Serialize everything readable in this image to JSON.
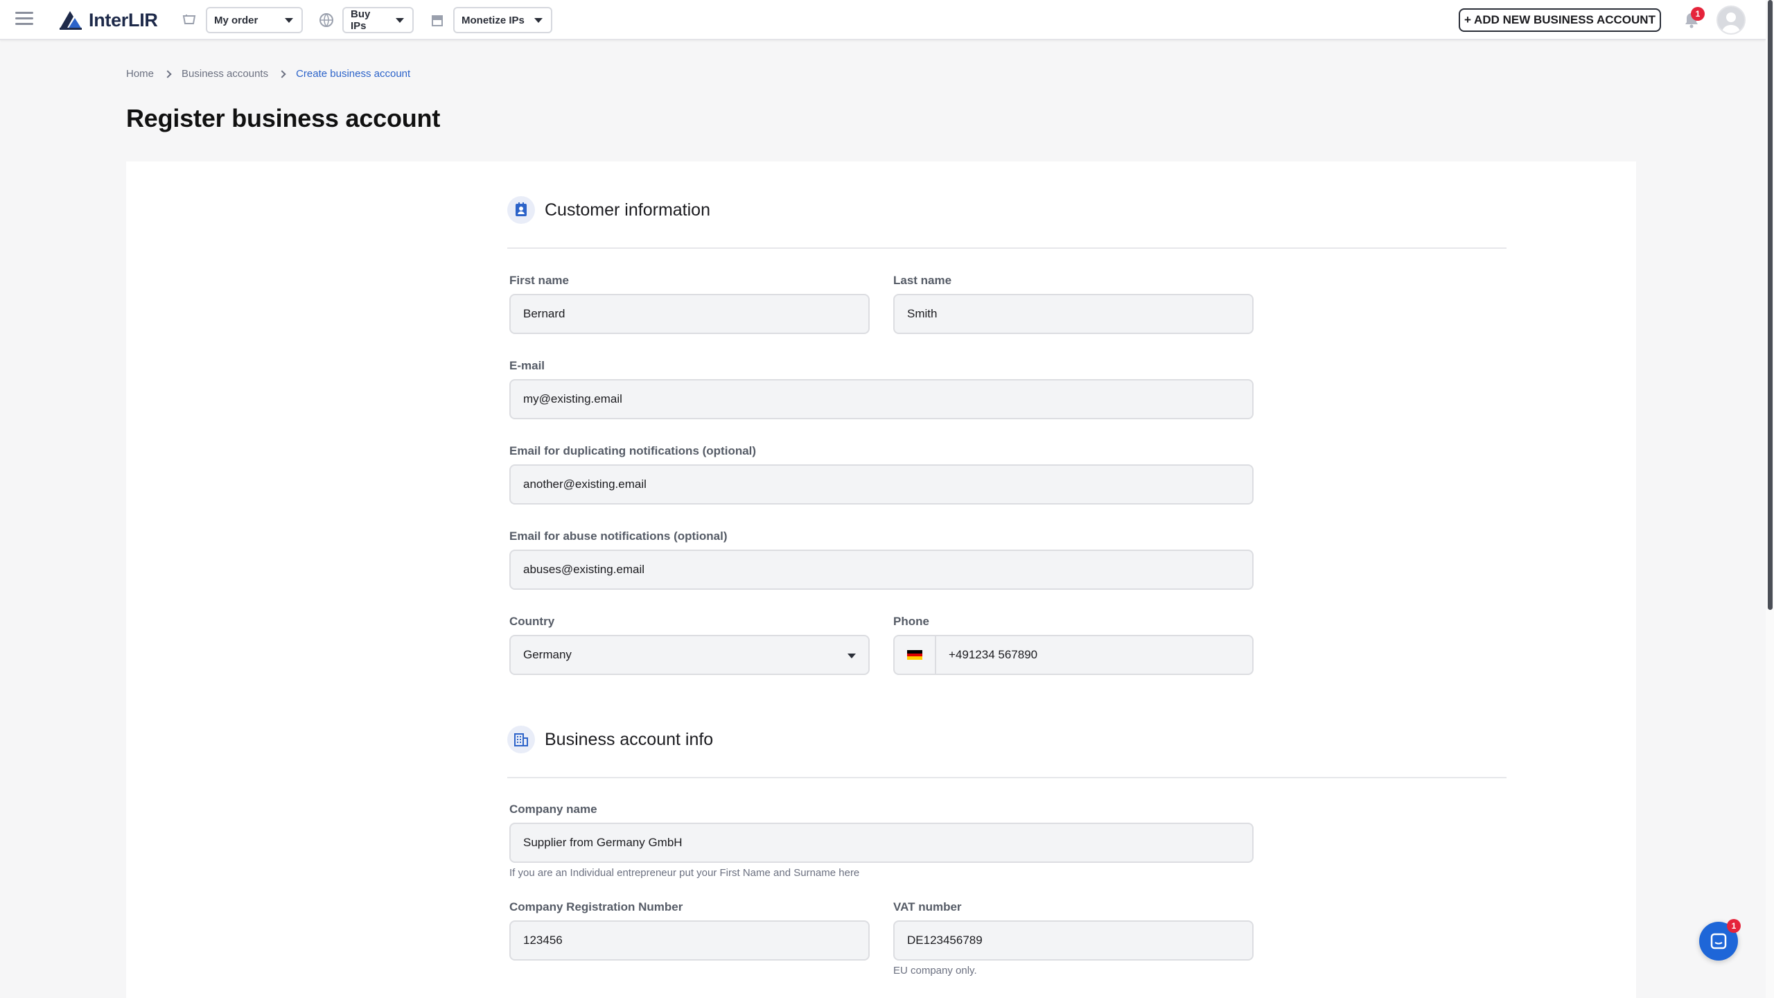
{
  "header": {
    "logo_text": "InterLIR",
    "nav": [
      {
        "label": "My order",
        "icon": "cart-icon"
      },
      {
        "label": "Buy IPs",
        "icon": "globe-icon"
      },
      {
        "label": "Monetize IPs",
        "icon": "store-icon"
      }
    ],
    "add_button_label": "+ ADD NEW BUSINESS ACCOUNT",
    "notification_count": "1"
  },
  "breadcrumb": {
    "home": "Home",
    "accounts": "Business accounts",
    "current": "Create business account"
  },
  "page_title": "Register business account",
  "customer_section": {
    "title": "Customer information",
    "icon": "contact-card-icon",
    "first_name": {
      "label": "First name",
      "value": "Bernard"
    },
    "last_name": {
      "label": "Last name",
      "value": "Smith"
    },
    "email": {
      "label": "E-mail",
      "value": "my@existing.email"
    },
    "email_dup": {
      "label": "Email for duplicating notifications (optional)",
      "value": "another@existing.email"
    },
    "email_abuse": {
      "label": "Email for abuse notifications (optional)",
      "value": "abuses@existing.email"
    },
    "country": {
      "label": "Country",
      "value": "Germany"
    },
    "phone": {
      "label": "Phone",
      "value": "+491234 567890",
      "flag": "de-flag-icon"
    }
  },
  "business_section": {
    "title": "Business account info",
    "icon": "building-icon",
    "company_name": {
      "label": "Company name",
      "value": "Supplier from Germany GmbH",
      "helper": "If you are an Individual entrepreneur put your First Name and Surname here"
    },
    "reg_number": {
      "label": "Company Registration Number",
      "value": "123456"
    },
    "vat": {
      "label": "VAT number",
      "value": "DE123456789",
      "helper": "EU company only."
    }
  },
  "chat": {
    "badge": "1"
  },
  "colors": {
    "accent": "#2c63c9",
    "chat": "#1e66d8",
    "badge": "#e5243b"
  }
}
